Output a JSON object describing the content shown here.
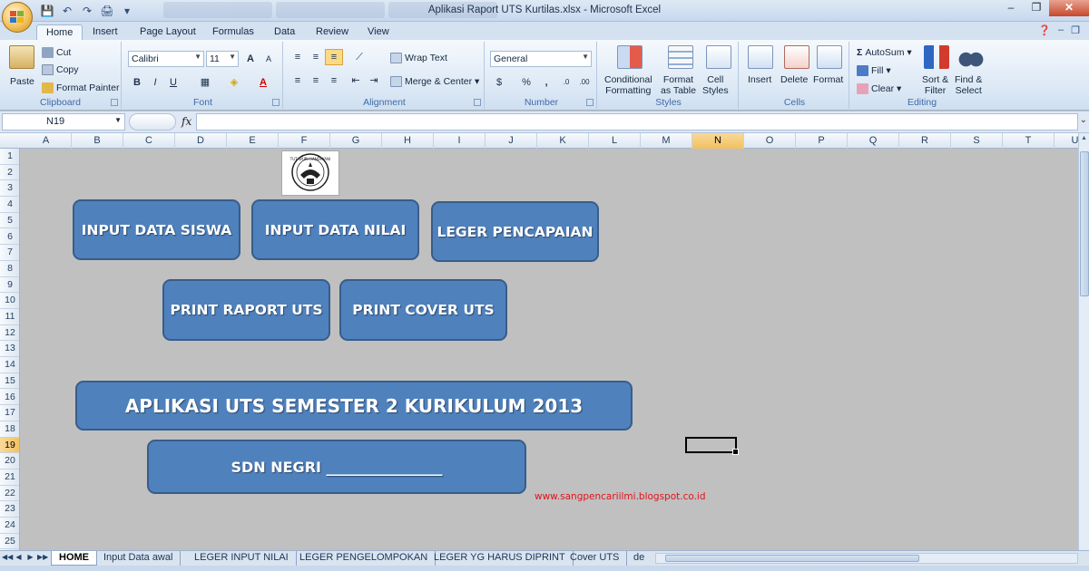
{
  "window": {
    "title": "Aplikasi Raport UTS Kurtilas.xlsx - Microsoft Excel",
    "controls": [
      "–",
      "❐",
      "✕"
    ]
  },
  "ribbon_tabs": [
    "Home",
    "Insert",
    "Page Layout",
    "Formulas",
    "Data",
    "Review",
    "View"
  ],
  "active_tab": "Home",
  "ribbon": {
    "clipboard": {
      "label": "Clipboard",
      "paste": "Paste",
      "cut": "Cut",
      "copy": "Copy",
      "format_painter": "Format Painter"
    },
    "font": {
      "label": "Font",
      "name": "Calibri",
      "size": "11",
      "bold": "B",
      "italic": "I",
      "underline": "U",
      "grow": "A",
      "shrink": "A"
    },
    "alignment": {
      "label": "Alignment",
      "wrap_text": "Wrap Text",
      "merge_center": "Merge & Center"
    },
    "number": {
      "label": "Number",
      "format": "General",
      "percent": "%",
      "comma": ","
    },
    "styles": {
      "label": "Styles",
      "conditional": "Conditional",
      "conditional2": "Formatting",
      "format_as": "Format",
      "format_as2": "as Table",
      "cell": "Cell",
      "cell2": "Styles"
    },
    "cells": {
      "label": "Cells",
      "insert": "Insert",
      "delete": "Delete",
      "format": "Format"
    },
    "editing": {
      "label": "Editing",
      "autosum": "AutoSum",
      "fill": "Fill",
      "clear": "Clear",
      "sort": "Sort &",
      "sort2": "Filter",
      "find": "Find &",
      "find2": "Select"
    }
  },
  "formula_bar": {
    "name_box": "N19",
    "fx": "fx",
    "value": ""
  },
  "columns": [
    "A",
    "B",
    "C",
    "D",
    "E",
    "F",
    "G",
    "H",
    "I",
    "J",
    "K",
    "L",
    "M",
    "N",
    "O",
    "P",
    "Q",
    "R",
    "S",
    "T",
    "U"
  ],
  "rows": [
    "1",
    "2",
    "3",
    "4",
    "5",
    "6",
    "7",
    "8",
    "9",
    "10",
    "11",
    "12",
    "13",
    "14",
    "15",
    "16",
    "17",
    "18",
    "19",
    "20",
    "21",
    "22",
    "23",
    "24",
    "25"
  ],
  "selected_cell": {
    "column": "N",
    "row": "19"
  },
  "sheet_buttons": {
    "input_siswa": "INPUT  DATA SISWA",
    "input_nilai": "INPUT  DATA NILAI",
    "leger": "LEGER PENCAPAIAN",
    "print_raport": "PRINT RAPORT UTS",
    "print_cover": "PRINT COVER UTS"
  },
  "banner_title": "APLIKASI UTS SEMESTER 2 KURIKULUM 2013",
  "school_label": "SDN NEGRI ________________",
  "logo_text": "TUT WURI HANDAYANI",
  "website": "www.sangpencariilmi.blogspot.co.id",
  "sheet_tabs": [
    "HOME",
    "Input Data awal",
    "LEGER INPUT NILAI",
    "LEGER PENGELOMPOKAN",
    "LEGER YG HARUS DIPRINT",
    "Cover UTS",
    "de"
  ],
  "active_sheet": "HOME",
  "colors": {
    "button_fill": "#4f81bd",
    "button_border": "#385d8a",
    "sheet_bg": "#c0c0c0",
    "link": "#e0121c"
  }
}
